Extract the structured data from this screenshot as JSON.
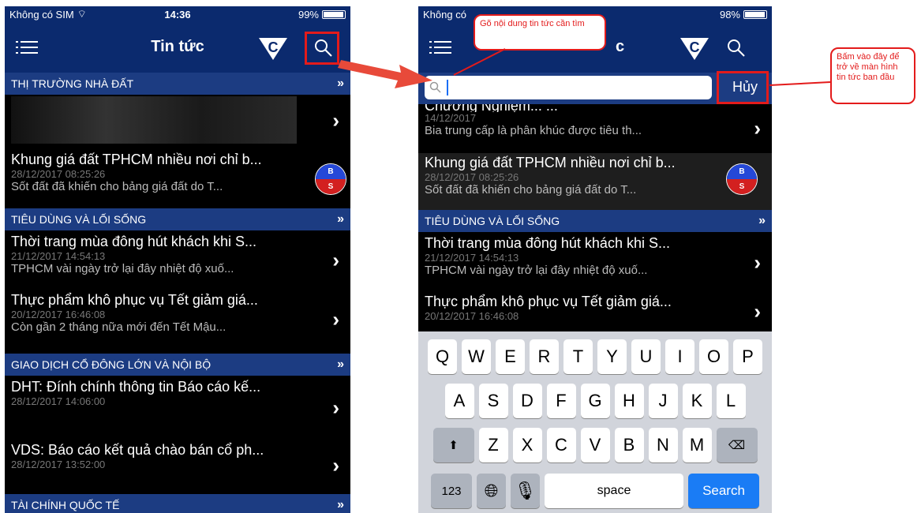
{
  "left": {
    "status": {
      "carrier": "Không có SIM",
      "time": "14:36",
      "battery": "99%"
    },
    "nav_title": "Tin tức",
    "sections": [
      {
        "label": "THỊ TRƯỜNG NHÀ ĐẤT"
      },
      {
        "label": "TIÊU DÙNG VÀ LỐI SỐNG"
      },
      {
        "label": "GIAO DỊCH CỔ ĐÔNG LỚN VÀ NỘI BỘ"
      },
      {
        "label": "TÀI CHÍNH QUỐC TẾ"
      }
    ],
    "items": [
      {
        "title": "Khung giá đất TPHCM nhiều nơi chỉ b...",
        "date": "28/12/2017 08:25:26",
        "sub": "Sốt đất đã khiến cho bảng giá đất do T..."
      },
      {
        "title": "Thời trang mùa đông hút khách khi S...",
        "date": "21/12/2017 14:54:13",
        "sub": "TPHCM vài ngày trở lại đây nhiệt độ xuố..."
      },
      {
        "title": "Thực phẩm khô phục vụ Tết giảm giá...",
        "date": "20/12/2017 16:46:08",
        "sub": "Còn gần 2 tháng nữa mới đến Tết Mậu..."
      },
      {
        "title": "DHT: Đính chính thông tin Báo cáo kế...",
        "date": "28/12/2017 14:06:00",
        "sub": ""
      },
      {
        "title": "VDS: Báo cáo kết quả chào bán cổ ph...",
        "date": "28/12/2017 13:52:00",
        "sub": ""
      }
    ]
  },
  "right": {
    "status": {
      "carrier": "Không có",
      "battery": "98%"
    },
    "nav_title_partial": "c",
    "search_placeholder": "",
    "cancel_label": "Hủy",
    "items": [
      {
        "title": "Chương Nghiệm... ...",
        "date": "14/12/2017",
        "sub": "Bia trung cấp là phân khúc được tiêu th..."
      },
      {
        "title": "Khung giá đất TPHCM nhiều nơi chỉ b...",
        "date": "28/12/2017 08:25:26",
        "sub": "Sốt đất đã khiến cho bảng giá đất do T..."
      },
      {
        "title": "Thời trang mùa đông hút khách khi S...",
        "date": "21/12/2017 14:54:13",
        "sub": "TPHCM vài ngày trở lại đây nhiệt độ xuố..."
      },
      {
        "title": "Thực phẩm khô phục vụ Tết giảm giá...",
        "date": "20/12/2017 16:46:08",
        "sub": ""
      }
    ],
    "section_label": "TIÊU DÙNG VÀ LỐI SỐNG",
    "keyboard": {
      "row1": [
        "Q",
        "W",
        "E",
        "R",
        "T",
        "Y",
        "U",
        "I",
        "O",
        "P"
      ],
      "row2": [
        "A",
        "S",
        "D",
        "F",
        "G",
        "H",
        "J",
        "K",
        "L"
      ],
      "row3": [
        "Z",
        "X",
        "C",
        "V",
        "B",
        "N",
        "M"
      ],
      "num_label": "123",
      "space_label": "space",
      "search_label": "Search"
    }
  },
  "badge": {
    "top": "B",
    "bottom": "S"
  },
  "callouts": {
    "search_hint": "Gõ nội dung tin tức cần tìm",
    "cancel_hint": "Bấm vào đây để trở về màn hình tin tức ban đầu"
  },
  "colors": {
    "nav": "#0b2a6e",
    "section": "#1c3c82",
    "highlight": "#e31b1b",
    "search_key": "#1a7cf5"
  }
}
